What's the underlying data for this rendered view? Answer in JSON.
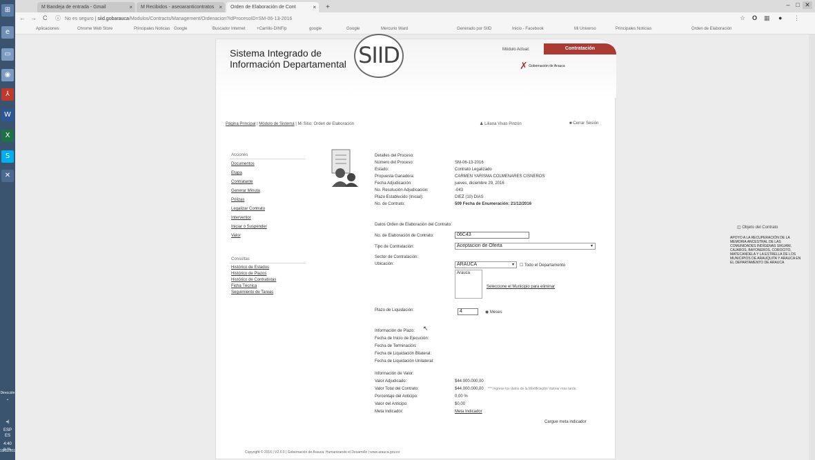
{
  "taskbar": {
    "tray_text": "Dirección",
    "lang": "ESP",
    "lang2": "ES",
    "time": "4:40 p.m.",
    "date": "10/11/2017"
  },
  "browser": {
    "tabs": [
      {
        "label": "M Bandeja de entrada - Gmail"
      },
      {
        "label": "M Recibidos - aseoaranticontratos"
      },
      {
        "label": "Orden de Elaboración de Cont"
      }
    ],
    "url_prefix": "No es seguro |",
    "url_host": "siid.gobarauca",
    "url_path": "/Modulos/Contracts/Management/Ordenacion?IdProcesoID=SM-06-13-2016",
    "bookmarks": [
      "Aplicaciones",
      "Chrome Web Store",
      "Principales Noticias",
      "Google",
      "Buscador Internet",
      "+Carrillo-DINF/p",
      "google",
      "Google",
      "Mercurio Ward",
      "Generado por SIID",
      "Inicio - Facebook",
      "Mi Universo",
      "Principales Noticias",
      "Orden de Elaboración"
    ]
  },
  "header": {
    "title_line1": "Sistema Integrado de",
    "title_line2": "Información Departamental",
    "logo": "SIID",
    "module_tab": "Módulo Actual:",
    "contract_tab": "Contratación",
    "gov": "Gobernación de Arauca"
  },
  "breadcrumb": {
    "home": "Página Principal",
    "module": "Módulo de Sistema",
    "current": "Mi Sitio: Orden de Elaboración"
  },
  "user": {
    "name": "Liliana Vivas Pinzón",
    "logout": "Cerrar Sesión"
  },
  "menu": {
    "acciones_title": "Acciones",
    "acciones": [
      "Documentos",
      "Etapa",
      "Contratante",
      "Generar Minuta",
      "Pólizas",
      "Legalizar Contrato",
      "Interventor",
      "Iniciar o Suspender",
      "Valor"
    ],
    "consultas_title": "Consultas",
    "consultas": [
      "Histórico de Estados",
      "Histórico de Plazos",
      "Histórico de Contratistas",
      "Ficha Técnica",
      "Seguimiento de Tareas"
    ]
  },
  "details": {
    "heading": "Detalles del Proceso:",
    "rows": [
      {
        "label": "Número del Proceso:",
        "value": "SM-06-13-2016"
      },
      {
        "label": "Estado:",
        "value": "Contrato Legalizado"
      },
      {
        "label": "Propuesta Ganadora:",
        "value": "CARMEN YARISMA COLMENARES CISNEROS"
      },
      {
        "label": "Fecha Adjudicación:",
        "value": "jueves, diciembre 29, 2016"
      },
      {
        "label": "No. Resolución Adjudicación:",
        "value": "-043"
      },
      {
        "label": "Plazo Establecido (Inicial):",
        "value": "DIEZ (10) DIAS"
      },
      {
        "label": "No. de Contrato:",
        "value": "509 Fecha de Enumeración: 21/12/2016"
      }
    ]
  },
  "orden": {
    "heading": "Datos Orden de Elaboración del Contrato:",
    "no_label": "No. de Elaboración de Contrato:",
    "no_value": "06C43",
    "tipo_label": "Tipo de Contratación:",
    "tipo_value": "Aceptacion de Oferta",
    "sector_label": "Sector de Contratación:",
    "ubicacion_label": "Ubicación:",
    "ubicacion_value": "ARAUCA",
    "todo_label": "Todo el Departamento",
    "municipio": "Arauca",
    "eliminar_link": "Seleccione el Municipio para eliminar",
    "plazo_liq_label": "Plazo de Liquidación:",
    "plazo_liq_value": "4",
    "meses_label": "Meses"
  },
  "plazo": {
    "heading": "Información de Plazo:",
    "rows": [
      "Fecha de Inicio de Ejecución:",
      "Fecha de Terminación:",
      "Fecha de Liquidación Bilateral:",
      "Fecha de Liquidación Unilateral:"
    ]
  },
  "valor": {
    "heading": "Información de Valor:",
    "rows": [
      {
        "label": "Valor Adjudicado:",
        "value": "$44.000.000,00"
      },
      {
        "label": "Valor Total del Contrato:",
        "value": "$44.000.000,00"
      },
      {
        "label": "Porcentaje del Anticipo:",
        "value": "0,00 %"
      },
      {
        "label": "Valor del Anticipo:",
        "value": "$0,00"
      },
      {
        "label": "Meta Indicador:",
        "value": "Meta Indicador"
      }
    ],
    "note": "*** Ingrese los datos de la Modificación Valorar más tarde.",
    "cargar": "Cargue meta indicador"
  },
  "objeto": {
    "title": "Objeto del Contrato",
    "text": "APOYO A LA RECUPERACIÓN DE LA MEMORIA ANCESTRAL DE LAS COMUNIDADES INDÍGENAS SIKUANI, CAJAROS, BAYONEROS, COROCITO, MATECANDELA Y LA ESTRELLA DE LOS MUNICIPIOS DE ARAUQUITA Y ARAUCA EN EL DEPARTAMENTO DE ARAUCA"
  },
  "footer": "Copyright © 2016 | V2.6.0 | Gobernación de Arauca: Humanizando el Desarrollo | www.arauca.gov.co"
}
